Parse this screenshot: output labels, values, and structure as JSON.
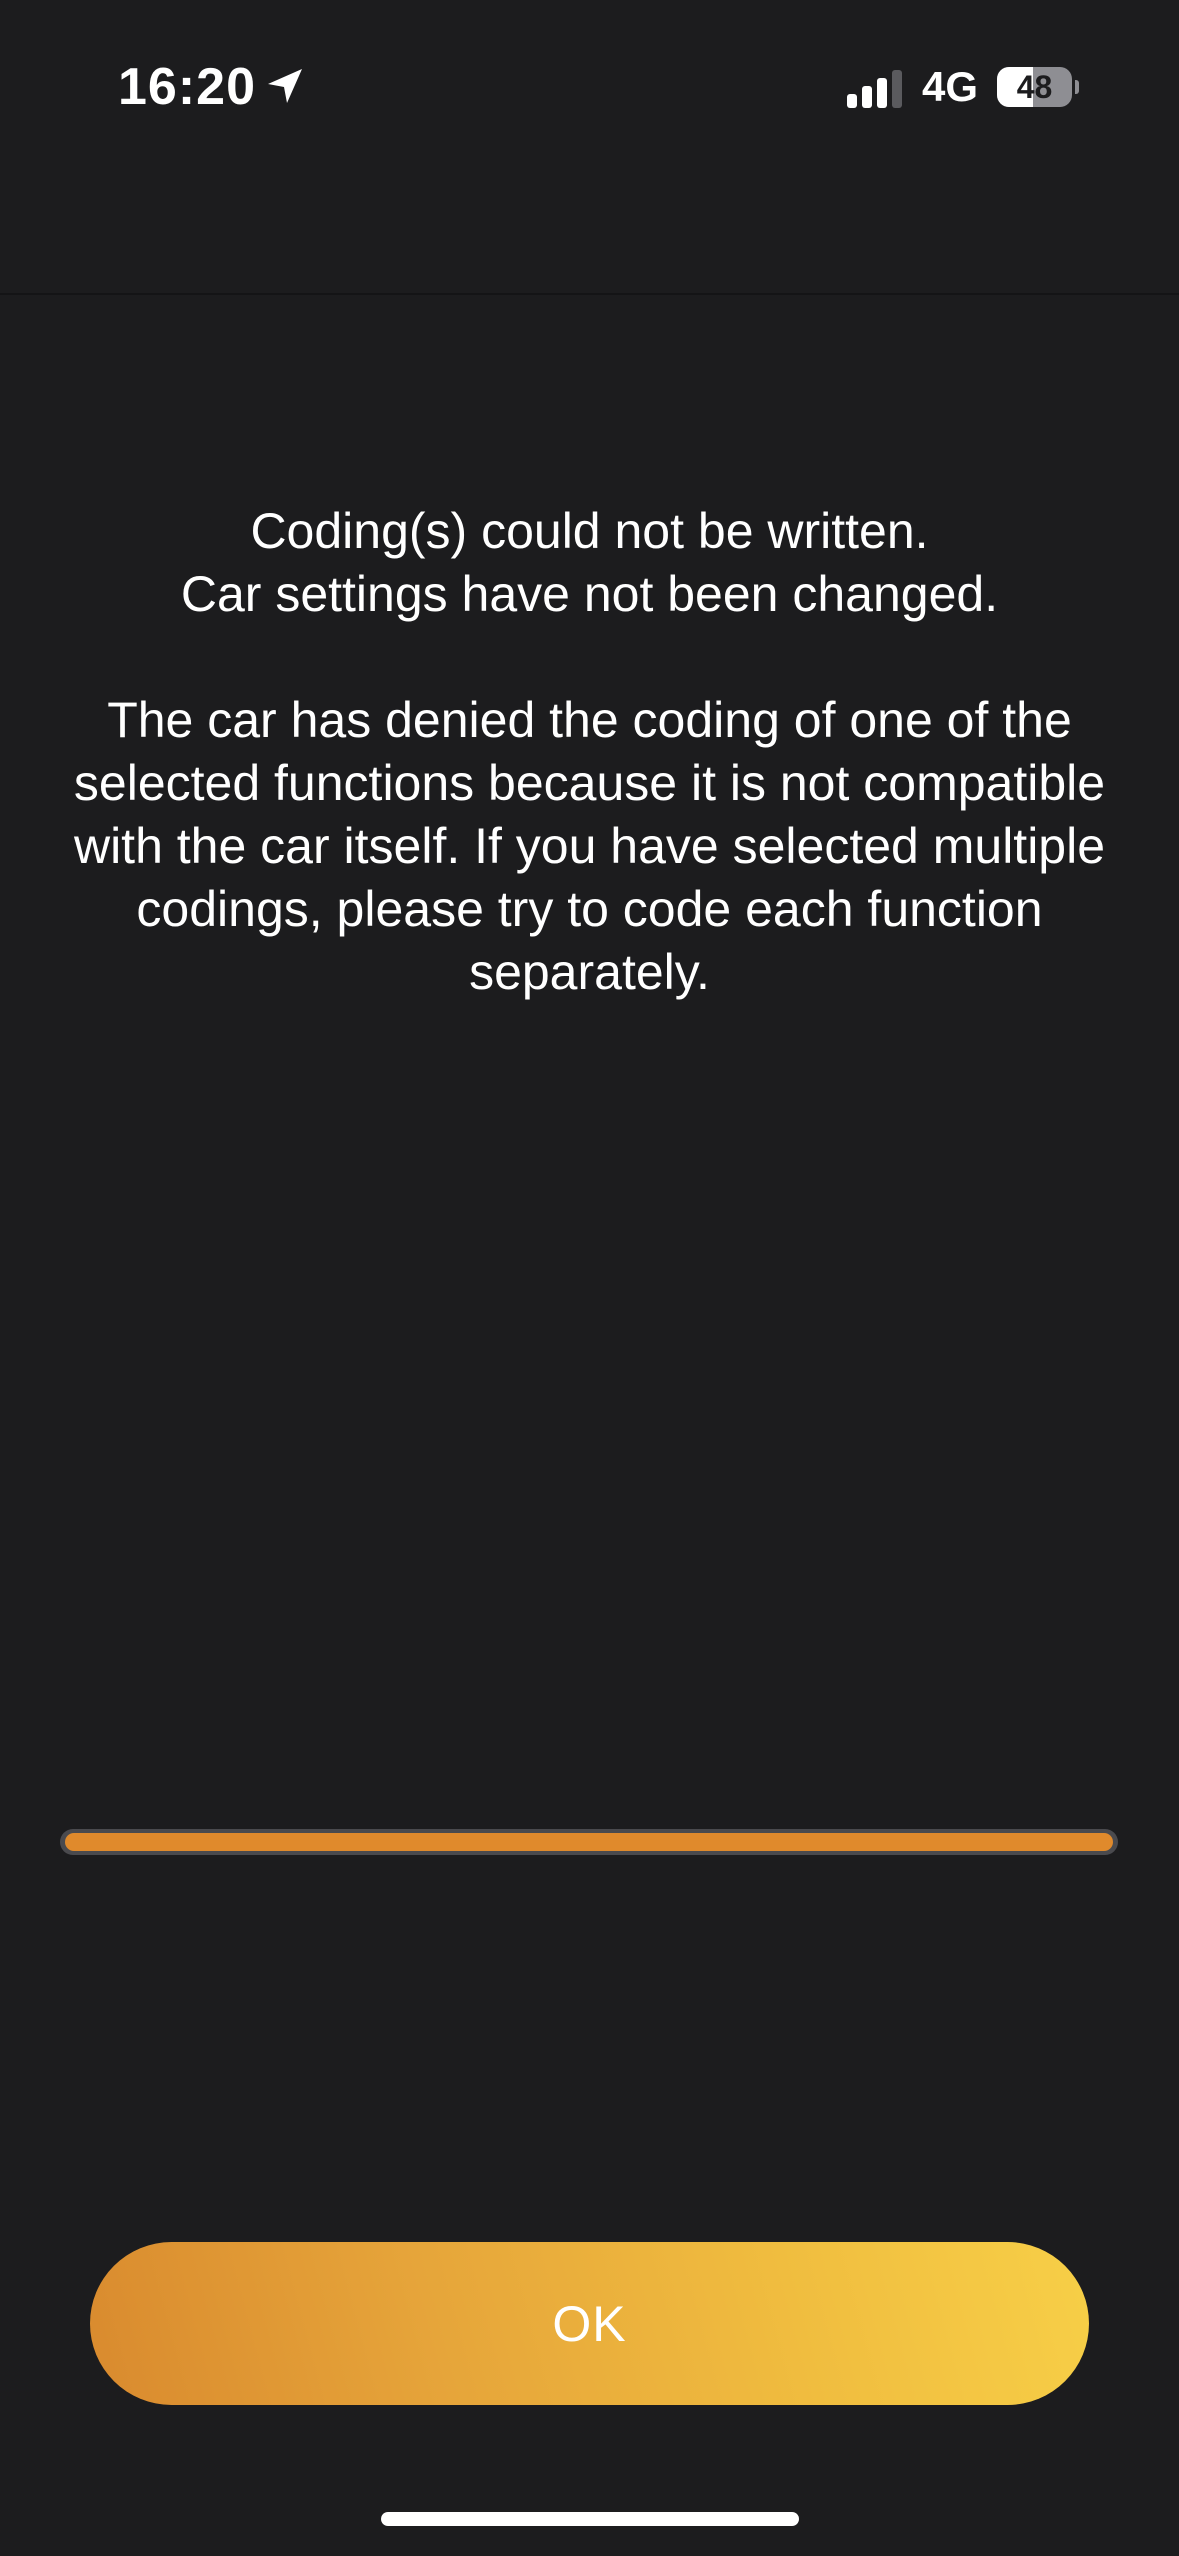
{
  "status_bar": {
    "time": "16:20",
    "network": "4G",
    "battery_level": "48",
    "battery_fraction": 0.48,
    "signal_bars_active": 3,
    "signal_bars_total": 4
  },
  "message": {
    "title_line_1": "Coding(s) could not be written.",
    "title_line_2": "Car settings have not been changed.",
    "body": "The car has denied the coding of one of the selected functions because it is not compatible with the car itself. If you have selected multiple codings, please try to code each function separately."
  },
  "progress": {
    "fraction": 1.0,
    "color": "#e08a2c"
  },
  "actions": {
    "ok_label": "OK"
  },
  "colors": {
    "background": "#1c1c1e",
    "button_gradient_start": "#d98a2e",
    "button_gradient_end": "#f7cf47",
    "text": "#ffffff"
  }
}
